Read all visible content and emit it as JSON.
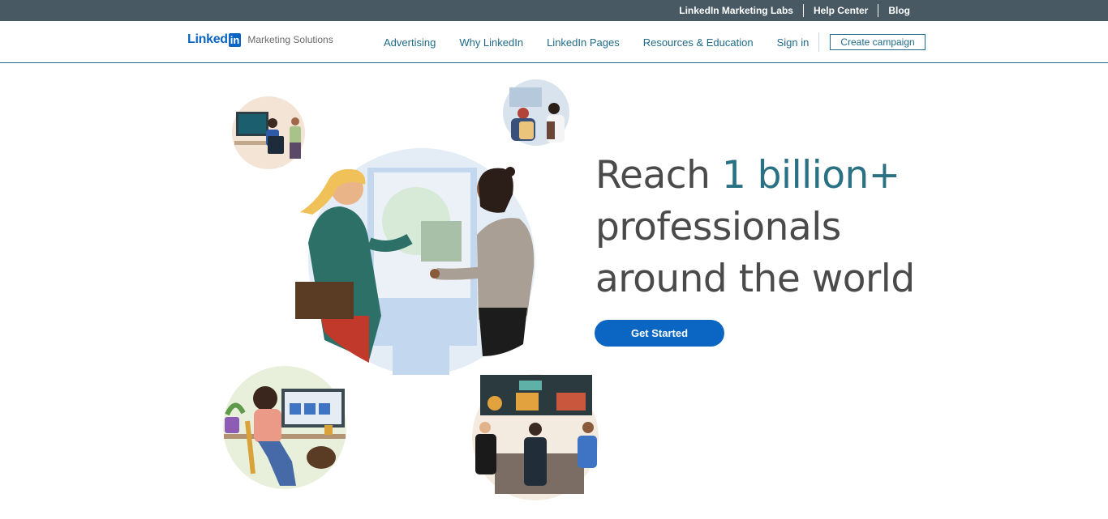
{
  "utility": {
    "links": [
      "LinkedIn Marketing Labs",
      "Help Center",
      "Blog"
    ]
  },
  "brand": {
    "word": "Linked",
    "box": "in",
    "sub": "Marketing Solutions",
    "color": "#0a66c2"
  },
  "nav": {
    "items": [
      "Advertising",
      "Why LinkedIn",
      "LinkedIn Pages",
      "Resources & Education"
    ],
    "signin": "Sign in",
    "create": "Create campaign"
  },
  "hero": {
    "line1_pre": "Reach ",
    "line1_accent": "1 billion+",
    "line2": "professionals",
    "line3": "around the world",
    "cta": "Get Started",
    "accent_color": "#2a7183"
  }
}
